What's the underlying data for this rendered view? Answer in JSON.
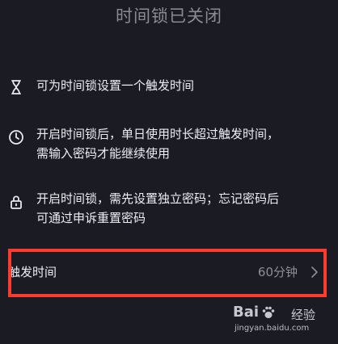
{
  "header": {
    "title": "时间锁已关闭"
  },
  "features": [
    {
      "icon": "hourglass-icon",
      "text": "可为时间锁设置一个触发时间"
    },
    {
      "icon": "clock-icon",
      "line1": "开启时间锁后，单日使用时长超过触发时间，",
      "line2": "需输入密码才能继续使用"
    },
    {
      "icon": "lock-icon",
      "line1": "开启时间锁，需先设置独立密码；忘记密码后",
      "line2": "可通过申诉重置密码"
    }
  ],
  "trigger": {
    "label": "触发时间",
    "value": "60分钟",
    "chevron_icon": "chevron-right-icon"
  },
  "annotation": {
    "color": "#ff3b30"
  },
  "watermark": {
    "brand": "Bai",
    "suffix": "经验",
    "url": "jingyan.baidu.com"
  }
}
